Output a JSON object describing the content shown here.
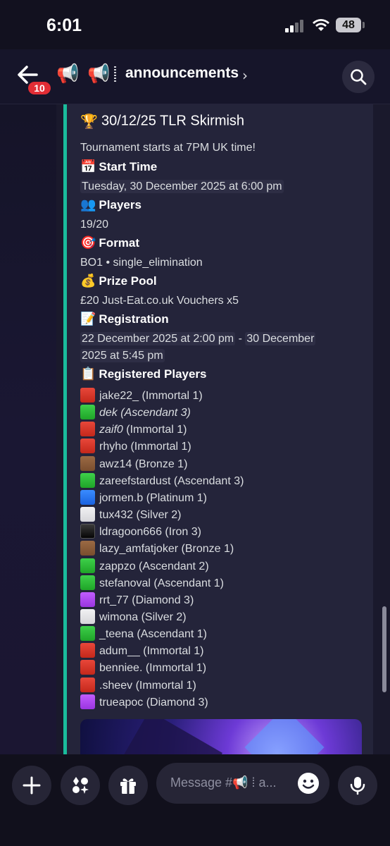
{
  "status_bar": {
    "time": "6:01",
    "battery": "48"
  },
  "header": {
    "unread_badge": "10",
    "channel_emoji_1": "📢",
    "channel_emoji_2": "📢",
    "channel_name": "announcements",
    "chevron": "›"
  },
  "embed": {
    "accent_color": "#1abc9c",
    "title_emoji": "🏆",
    "title": "30/12/25 TLR Skirmish",
    "description": "Tournament starts at 7PM UK time!",
    "fields": {
      "start_time": {
        "emoji": "📅",
        "name": "Start Time",
        "value": "Tuesday, 30 December 2025 at 6:00 pm"
      },
      "players": {
        "emoji": "👥",
        "name": "Players",
        "value": "19/20"
      },
      "format": {
        "emoji": "🎯",
        "name": "Format",
        "value": "BO1 • single_elimination"
      },
      "prize_pool": {
        "emoji": "💰",
        "name": "Prize Pool",
        "value": "£20 Just-Eat.co.uk Vouchers x5"
      },
      "registration": {
        "emoji": "📝",
        "name": "Registration",
        "value_start": "22 December 2025 at 2:00 pm",
        "separator": " - ",
        "value_end_line1": "30 December",
        "value_end_line2": "2025 at 5:45 pm"
      },
      "registered_players": {
        "emoji": "📋",
        "name": "Registered Players"
      }
    },
    "players": [
      {
        "color": "red",
        "name": "jake22_",
        "rank": " (Immortal 1)",
        "italic": false
      },
      {
        "color": "green",
        "name": "dek",
        "rank": " (Ascendant 3)",
        "italic": true
      },
      {
        "color": "red",
        "name": "zaif0",
        "rank": " (Immortal 1)",
        "italic": "name"
      },
      {
        "color": "red",
        "name": "rhyho",
        "rank": " (Immortal 1)",
        "italic": false
      },
      {
        "color": "brown",
        "name": "awz14",
        "rank": " (Bronze 1)",
        "italic": false
      },
      {
        "color": "green",
        "name": "zareefstardust",
        "rank": " (Ascendant 3)",
        "italic": false
      },
      {
        "color": "blue",
        "name": "jormen.b",
        "rank": " (Platinum 1)",
        "italic": false
      },
      {
        "color": "white",
        "name": "tux432",
        "rank": " (Silver 2)",
        "italic": false
      },
      {
        "color": "black",
        "name": "ldragoon666",
        "rank": " (Iron 3)",
        "italic": false
      },
      {
        "color": "brown",
        "name": "lazy_amfatjoker",
        "rank": " (Bronze 1)",
        "italic": false
      },
      {
        "color": "green",
        "name": "zappzo",
        "rank": " (Ascendant 2)",
        "italic": false
      },
      {
        "color": "green",
        "name": "stefanoval",
        "rank": " (Ascendant 1)",
        "italic": false
      },
      {
        "color": "purple",
        "name": "rrt_77",
        "rank": " (Diamond 3)",
        "italic": false
      },
      {
        "color": "white",
        "name": "wimona",
        "rank": " (Silver 2)",
        "italic": false
      },
      {
        "color": "green",
        "name": "_teena",
        "rank": " (Ascendant 1)",
        "italic": false
      },
      {
        "color": "red",
        "name": "adum__",
        "rank": " (Immortal 1)",
        "italic": false
      },
      {
        "color": "red",
        "name": "benniee.",
        "rank": " (Immortal 1)",
        "italic": false
      },
      {
        "color": "red",
        "name": ".sheev",
        "rank": " (Immortal 1)",
        "italic": false
      },
      {
        "color": "purple",
        "name": "trueapoc",
        "rank": " (Diamond 3)",
        "italic": false
      }
    ]
  },
  "composer": {
    "placeholder": "Message #📢 ⁞ a..."
  },
  "icons": {
    "back": "arrow-left-icon",
    "megaphone": "megaphone-icon",
    "search": "search-icon",
    "add": "plus-icon",
    "apps": "apps-icon",
    "gift": "gift-icon",
    "emoji": "emoji-icon",
    "mic": "microphone-icon"
  }
}
